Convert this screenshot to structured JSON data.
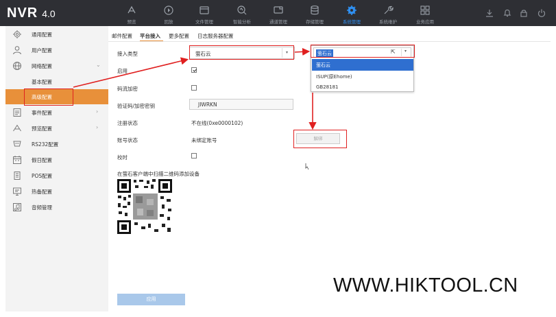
{
  "brand": {
    "name": "NVR",
    "version": "4.0"
  },
  "nav": [
    {
      "label": "预览",
      "icon": "preview-icon"
    },
    {
      "label": "回放",
      "icon": "playback-icon"
    },
    {
      "label": "文件管理",
      "icon": "folder-icon"
    },
    {
      "label": "智能分析",
      "icon": "analysis-icon"
    },
    {
      "label": "通道管理",
      "icon": "camera-icon"
    },
    {
      "label": "存储管理",
      "icon": "storage-icon"
    },
    {
      "label": "系统管理",
      "icon": "gear-icon",
      "active": true
    },
    {
      "label": "系统维护",
      "icon": "wrench-icon"
    },
    {
      "label": "业务应用",
      "icon": "apps-icon"
    }
  ],
  "tools": [
    "download-icon",
    "bell-icon",
    "lock-icon",
    "power-icon"
  ],
  "sidebar": {
    "items": [
      {
        "label": "通用配置",
        "icon": "gear-outline-icon"
      },
      {
        "label": "用户配置",
        "icon": "user-icon"
      },
      {
        "label": "网络配置",
        "icon": "globe-icon",
        "expanded": true
      },
      {
        "label": "基本配置"
      },
      {
        "label": "高级配置",
        "active": true
      },
      {
        "label": "事件配置",
        "icon": "event-icon"
      },
      {
        "label": "预览配置",
        "icon": "preview-config-icon"
      },
      {
        "label": "RS232配置",
        "icon": "rs232-icon"
      },
      {
        "label": "假日配置",
        "icon": "calendar-icon"
      },
      {
        "label": "POS配置",
        "icon": "pos-icon"
      },
      {
        "label": "热备配置",
        "icon": "hot-spare-icon"
      },
      {
        "label": "音频管理",
        "icon": "audio-icon"
      }
    ]
  },
  "tabs": [
    {
      "label": "邮件配置"
    },
    {
      "label": "平台接入",
      "active": true
    },
    {
      "label": "更多配置"
    },
    {
      "label": "日志服务器配置"
    }
  ],
  "form": {
    "access_type_label": "接入类型",
    "access_type_value": "萤石云",
    "enable_label": "启用",
    "enable_checked": true,
    "stream_encrypt_label": "码流加密",
    "stream_encrypt_checked": false,
    "verify_code_label": "验证码/加密密钥",
    "verify_code_value": "JIWRKN",
    "register_status_label": "注册状态",
    "register_status_value": "不在线(0xe0000102)",
    "account_status_label": "账号状态",
    "account_status_value": "未绑定账号",
    "bind_button": "解绑",
    "time_sync_label": "校时",
    "time_sync_checked": false,
    "qr_caption": "在萤石客户端中扫描二维码添加设备",
    "apply_button": "应用"
  },
  "dropdown": {
    "current": "萤石云",
    "options": [
      {
        "label": "萤石云",
        "selected": true
      },
      {
        "label": "ISUP(原Ehome)"
      },
      {
        "label": "GB28181"
      }
    ]
  },
  "watermark": "WWW.HIKTOOL.CN",
  "colors": {
    "topbar": "#2e2f34",
    "accent_orange": "#e8903a",
    "nav_active": "#2f8ff0",
    "highlight_blue": "#2f6fd0",
    "annotation_red": "#e02020"
  }
}
